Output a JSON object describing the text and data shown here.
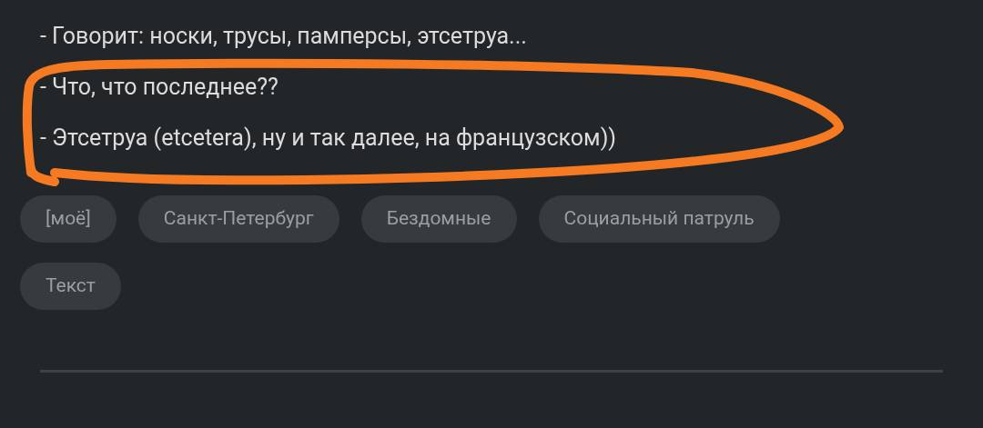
{
  "lines": [
    "- Говорит: носки, трусы, памперсы, этсетруа...",
    "- Что, что последнее??",
    "- Этсетруа (etcetera), ну и так далее, на французском))"
  ],
  "tags": [
    "[моё]",
    "Санкт-Петербург",
    "Бездомные",
    "Социальный патруль",
    "Текст"
  ]
}
